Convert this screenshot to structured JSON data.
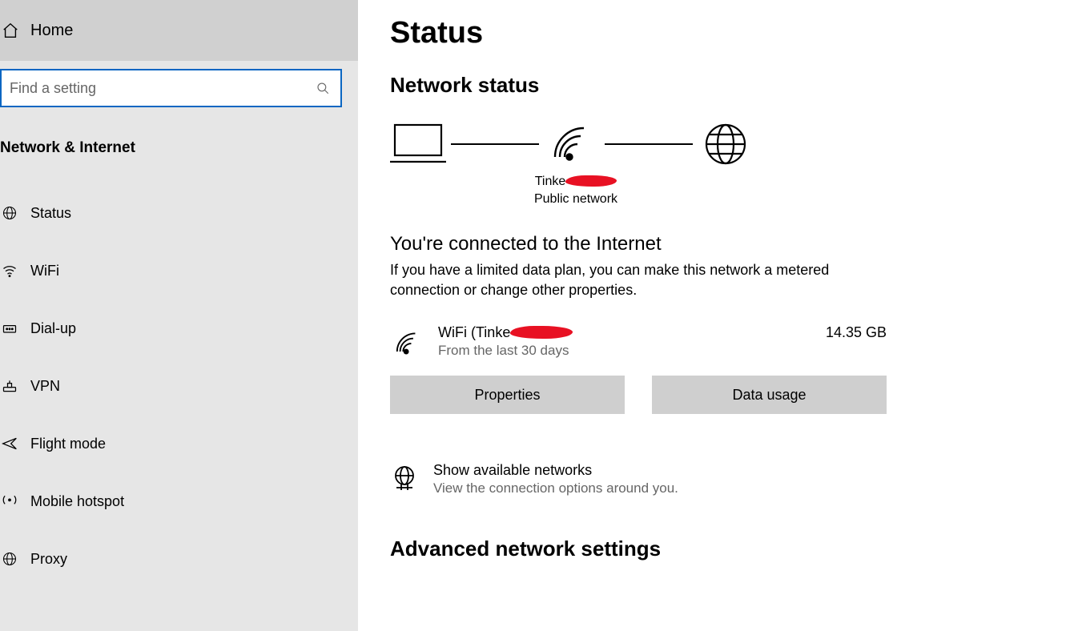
{
  "sidebar": {
    "home_label": "Home",
    "search_placeholder": "Find a setting",
    "section_heading": "Network & Internet",
    "items": [
      {
        "id": "status",
        "label": "Status",
        "icon": "globe"
      },
      {
        "id": "wifi",
        "label": "WiFi",
        "icon": "wifi"
      },
      {
        "id": "dialup",
        "label": "Dial-up",
        "icon": "dialup"
      },
      {
        "id": "vpn",
        "label": "VPN",
        "icon": "vpn"
      },
      {
        "id": "flight",
        "label": "Flight mode",
        "icon": "airplane"
      },
      {
        "id": "hotspot",
        "label": "Mobile hotspot",
        "icon": "hotspot"
      },
      {
        "id": "proxy",
        "label": "Proxy",
        "icon": "globe"
      }
    ]
  },
  "main": {
    "page_title": "Status",
    "network_status_heading": "Network status",
    "topology": {
      "network_name_visible_prefix": "Tinke",
      "network_type": "Public network"
    },
    "connected_heading": "You're connected to the Internet",
    "connected_desc": "If you have a limited data plan, you can make this network a metered connection or change other properties.",
    "connection": {
      "title_prefix": "WiFi (Tinke",
      "subtitle": "From the last 30 days",
      "data_used": "14.35 GB"
    },
    "buttons": {
      "properties": "Properties",
      "data_usage": "Data usage"
    },
    "available": {
      "title": "Show available networks",
      "subtitle": "View the connection options around you."
    },
    "advanced_heading": "Advanced network settings"
  }
}
